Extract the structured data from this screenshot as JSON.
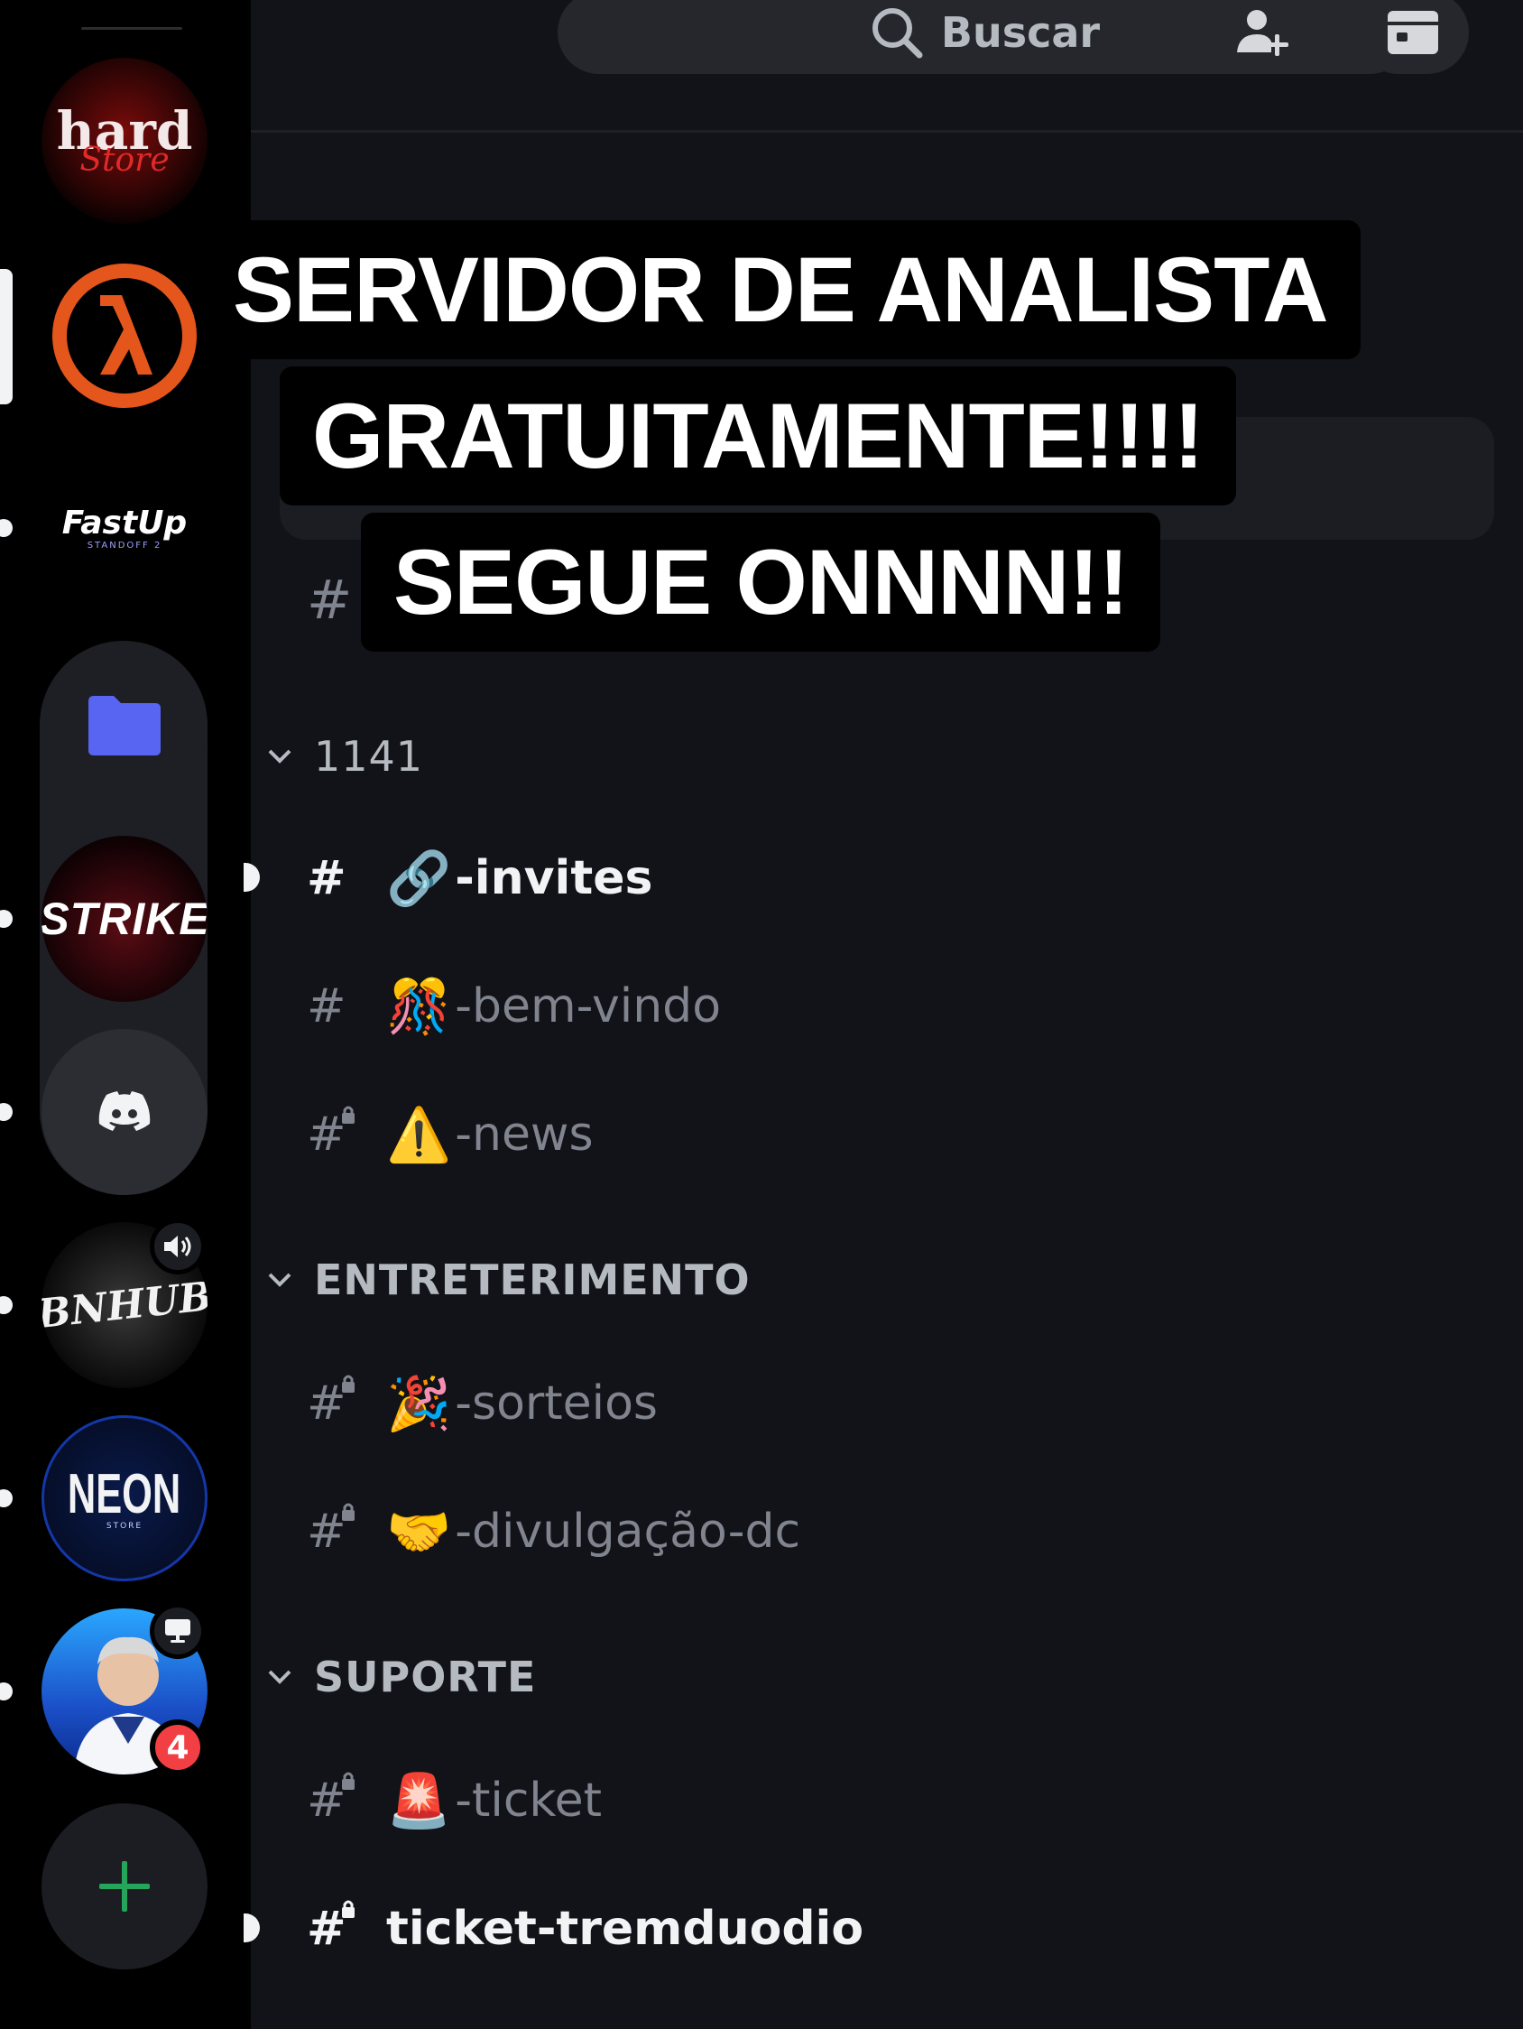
{
  "search": {
    "placeholder": "Buscar"
  },
  "caption": {
    "line1": "SERVIDOR DE ANALISTA",
    "line2": "GRATUITAMENTE!!!!",
    "line3": "SEGUE ONNNN!!"
  },
  "servers": [
    {
      "name": "hard Store",
      "text": "hard",
      "subtext": "Store"
    },
    {
      "name": "Half-Life",
      "text": "λ"
    },
    {
      "name": "FastUp Standoff 2",
      "text": "FastUp",
      "subtext": "STANDOFF 2"
    },
    {
      "name": "Folder",
      "color": "#5865f2"
    },
    {
      "name": "STRIKE",
      "text": "STRIKE"
    },
    {
      "name": "Discord"
    },
    {
      "name": "BNHUB",
      "text": "BNHUB"
    },
    {
      "name": "NEON Store",
      "text": "NEON",
      "subtext": "STORE"
    },
    {
      "name": "User server",
      "badge": "4"
    }
  ],
  "categories": [
    {
      "label": "1141",
      "channels": [
        {
          "emoji": "🔗",
          "name": "-invites",
          "unread": true,
          "locked": false
        },
        {
          "emoji": "🎊",
          "name": "-bem-vindo",
          "unread": false,
          "locked": false
        },
        {
          "emoji": "⚠️",
          "name": "-news",
          "unread": false,
          "locked": true
        }
      ]
    },
    {
      "label": "ENTRETERIMENTO",
      "channels": [
        {
          "emoji": "🎉",
          "name": "-sorteios",
          "unread": false,
          "locked": true
        },
        {
          "emoji": "🤝",
          "name": "-divulgação-dc",
          "unread": false,
          "locked": true
        }
      ]
    },
    {
      "label": "SUPORTE",
      "channels": [
        {
          "emoji": "🚨",
          "name": "-ticket",
          "unread": false,
          "locked": true
        },
        {
          "emoji": "",
          "name": "ticket-tremduodio",
          "unread": true,
          "locked": true
        }
      ]
    }
  ],
  "colors": {
    "background": "#121318",
    "rail": "#000000",
    "accent": "#5865f2",
    "green": "#23a55a",
    "badge": "#f23f43"
  }
}
